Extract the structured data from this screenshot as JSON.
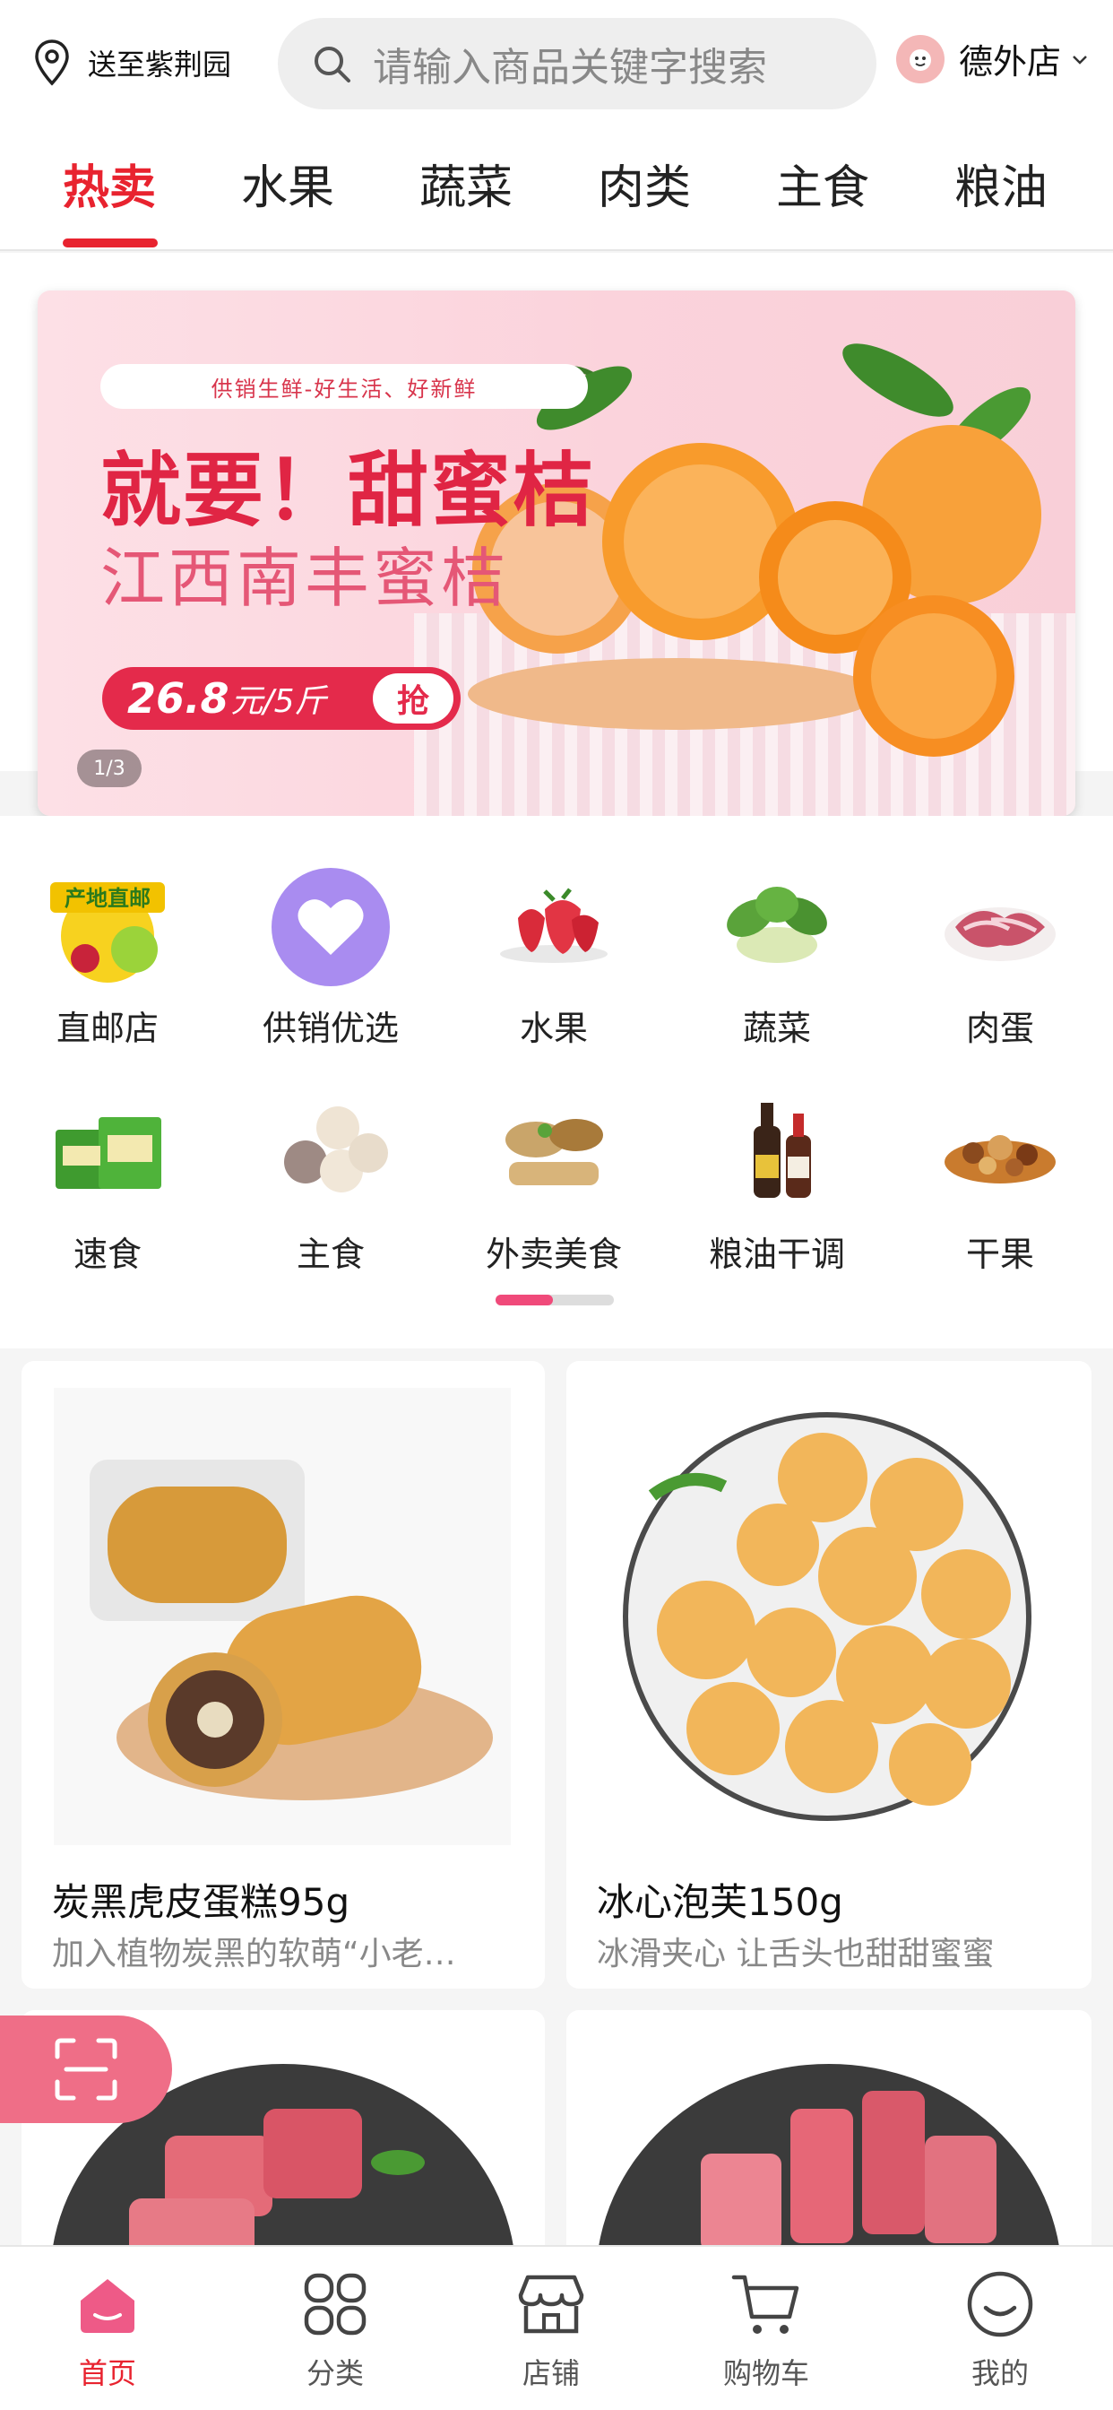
{
  "header": {
    "location": "送至紫荆园",
    "search_placeholder": "请输入商品关键字搜索",
    "store_name": "德外店"
  },
  "tabs": [
    "热卖",
    "水果",
    "蔬菜",
    "肉类",
    "主食",
    "粮油"
  ],
  "banner": {
    "tagline": "供销生鲜-好生活、好新鲜",
    "headline": "就要！甜蜜桔",
    "subheadline": "江西南丰蜜桔",
    "price": "26.8",
    "price_unit": "元/5斤",
    "grab": "抢",
    "pager": "1/3"
  },
  "categories": [
    {
      "label": "直邮店",
      "badge": "产地直邮"
    },
    {
      "label": "供销优选"
    },
    {
      "label": "水果"
    },
    {
      "label": "蔬菜"
    },
    {
      "label": "肉蛋"
    },
    {
      "label": "速食"
    },
    {
      "label": "主食"
    },
    {
      "label": "外卖美食"
    },
    {
      "label": "粮油干调"
    },
    {
      "label": "干果"
    }
  ],
  "products": [
    {
      "title": "炭黑虎皮蛋糕95g",
      "desc": "加入植物炭黑的软萌“小老…"
    },
    {
      "title": "冰心泡芙150g",
      "desc": "冰滑夹心 让舌头也甜甜蜜蜜"
    }
  ],
  "bottom_nav": [
    {
      "label": "首页",
      "icon": "home-icon"
    },
    {
      "label": "分类",
      "icon": "grid-icon"
    },
    {
      "label": "店铺",
      "icon": "store-icon"
    },
    {
      "label": "购物车",
      "icon": "cart-icon"
    },
    {
      "label": "我的",
      "icon": "smile-icon"
    }
  ],
  "colors": {
    "accent": "#e8232f",
    "banner_red": "#e02544",
    "scan": "#ef6e87"
  }
}
